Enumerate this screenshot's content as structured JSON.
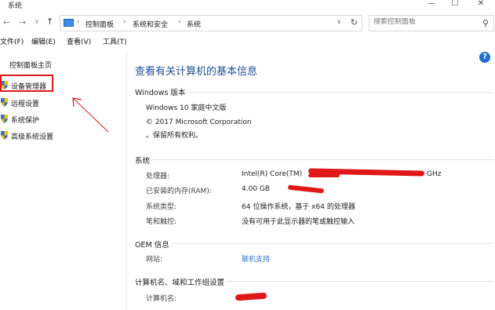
{
  "window": {
    "title": "系统"
  },
  "address": {
    "crumbs": [
      "控制面板",
      "系统和安全",
      "系统"
    ],
    "search_placeholder": "搜索控制面板"
  },
  "menu": [
    "文件(F)",
    "编辑(E)",
    "查看(V)",
    "工具(T)"
  ],
  "sidebar": {
    "home": "控制面板主页",
    "items": [
      {
        "label": "设备管理器"
      },
      {
        "label": "远程设置"
      },
      {
        "label": "系统保护"
      },
      {
        "label": "高级系统设置"
      }
    ]
  },
  "main": {
    "heading": "查看有关计算机的基本信息",
    "windows_section": {
      "title": "Windows 版本",
      "edition": "Windows 10 家庭中文版",
      "copyright": "© 2017 Microsoft Corporation",
      "rights": "。保留所有权利。"
    },
    "system_section": {
      "title": "系统",
      "rows": [
        {
          "label": "处理器:",
          "value": "Intel(R) Core(TM)",
          "value_tail": "GHz"
        },
        {
          "label": "已安装的内存(RAM):",
          "value": "4.00 GB"
        },
        {
          "label": "系统类型:",
          "value": "64 位操作系统，基于 x64 的处理器"
        },
        {
          "label": "笔和触控:",
          "value": "没有可用于此显示器的笔或触控输入"
        }
      ]
    },
    "oem_section": {
      "title": "OEM 信息",
      "website_label": "网站:",
      "website_value": "联机支持"
    },
    "computer_section": {
      "title": "计算机名、域和工作组设置",
      "name_label": "计算机名:"
    }
  },
  "colors": {
    "heading": "#1f4e9c",
    "link": "#2a6fd6",
    "annotation_red": "#e01818"
  }
}
